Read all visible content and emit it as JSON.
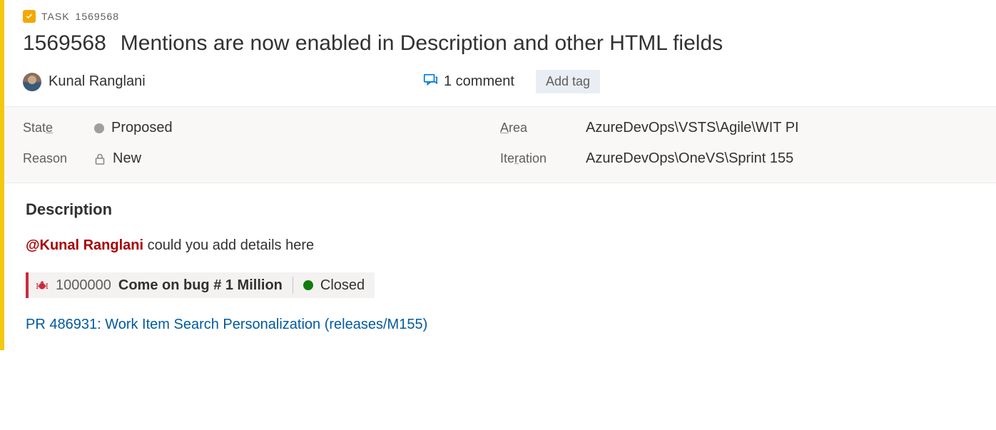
{
  "crumb": {
    "type": "TASK",
    "id": "1569568"
  },
  "title": {
    "id": "1569568",
    "text": "Mentions are now enabled in Description and other HTML fields"
  },
  "assignee": {
    "name": "Kunal Ranglani"
  },
  "comments": {
    "count_label": "1 comment"
  },
  "add_tag": {
    "label": "Add tag"
  },
  "fields": {
    "state": {
      "label": "State",
      "value": "Proposed"
    },
    "reason": {
      "label": "Reason",
      "value": "New"
    },
    "area": {
      "label": "Area",
      "value": "AzureDevOps\\VSTS\\Agile\\WIT PI"
    },
    "iteration": {
      "label": "Iteration",
      "value": "AzureDevOps\\OneVS\\Sprint 155"
    }
  },
  "description": {
    "heading": "Description",
    "mention": "@Kunal Ranglani",
    "mention_suffix": " could you add details here",
    "linked_item": {
      "id": "1000000",
      "title": "Come on bug # 1 Million",
      "state": "Closed"
    },
    "pr_link": "PR 486931: Work Item Search Personalization (releases/M155)"
  }
}
